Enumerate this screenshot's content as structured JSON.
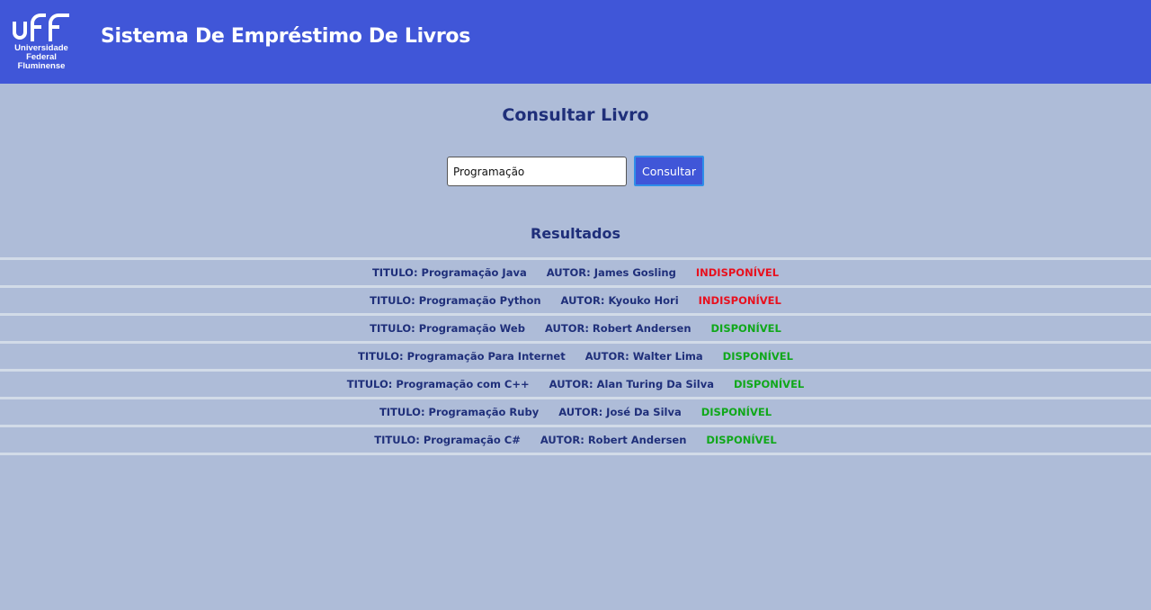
{
  "header": {
    "logo": {
      "mark": "uff",
      "lines": [
        "Universidade",
        "Federal",
        "Fluminense"
      ]
    },
    "title": "Sistema De Empréstimo De Livros"
  },
  "search": {
    "title": "Consultar Livro",
    "value": "Programação",
    "placeholder": "",
    "button_label": "Consultar"
  },
  "results": {
    "title": "Resultados",
    "title_prefix": "TITULO:",
    "author_prefix": "AUTOR:",
    "items": [
      {
        "title": "Programação Java",
        "author": "James Gosling",
        "status": "INDISPONÍVEL",
        "available": false
      },
      {
        "title": "Programação Python",
        "author": "Kyouko Hori",
        "status": "INDISPONÍVEL",
        "available": false
      },
      {
        "title": "Programação Web",
        "author": "Robert Andersen",
        "status": "DISPONÍVEL",
        "available": true
      },
      {
        "title": "Programação Para Internet",
        "author": "Walter Lima",
        "status": "DISPONÍVEL",
        "available": true
      },
      {
        "title": "Programação com C++",
        "author": "Alan Turing Da Silva",
        "status": "DISPONÍVEL",
        "available": true
      },
      {
        "title": "Programação Ruby",
        "author": "José Da Silva",
        "status": "DISPONÍVEL",
        "available": true
      },
      {
        "title": "Programação C#",
        "author": "Robert Andersen",
        "status": "DISPONÍVEL",
        "available": true
      }
    ]
  },
  "colors": {
    "header_bg": "#4056d8",
    "page_bg": "#aebcd8",
    "heading_text": "#1f2f7a",
    "available": "#10a81a",
    "unavailable": "#e8101e",
    "row_divider": "#d2dbe8"
  }
}
